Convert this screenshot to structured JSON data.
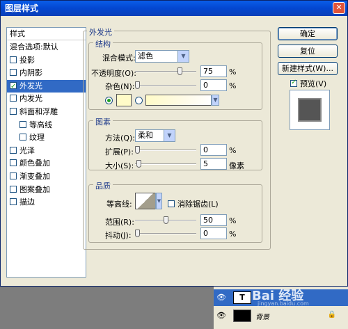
{
  "window": {
    "title": "图层样式",
    "close_glyph": "✕"
  },
  "left_list": {
    "header": "样式",
    "items": [
      {
        "label": "混合选项:默认",
        "checkbox": false,
        "checked": false,
        "selected": false,
        "indent": 0
      },
      {
        "label": "投影",
        "checkbox": true,
        "checked": false,
        "selected": false,
        "indent": 0
      },
      {
        "label": "内阴影",
        "checkbox": true,
        "checked": false,
        "selected": false,
        "indent": 0
      },
      {
        "label": "外发光",
        "checkbox": true,
        "checked": true,
        "selected": true,
        "indent": 0
      },
      {
        "label": "内发光",
        "checkbox": true,
        "checked": false,
        "selected": false,
        "indent": 0
      },
      {
        "label": "斜面和浮雕",
        "checkbox": true,
        "checked": false,
        "selected": false,
        "indent": 0
      },
      {
        "label": "等高线",
        "checkbox": true,
        "checked": false,
        "selected": false,
        "indent": 1
      },
      {
        "label": "纹理",
        "checkbox": true,
        "checked": false,
        "selected": false,
        "indent": 1
      },
      {
        "label": "光泽",
        "checkbox": true,
        "checked": false,
        "selected": false,
        "indent": 0
      },
      {
        "label": "颜色叠加",
        "checkbox": true,
        "checked": false,
        "selected": false,
        "indent": 0
      },
      {
        "label": "渐变叠加",
        "checkbox": true,
        "checked": false,
        "selected": false,
        "indent": 0
      },
      {
        "label": "图案叠加",
        "checkbox": true,
        "checked": false,
        "selected": false,
        "indent": 0
      },
      {
        "label": "描边",
        "checkbox": true,
        "checked": false,
        "selected": false,
        "indent": 0
      }
    ]
  },
  "panel": {
    "title": "外发光",
    "structure": {
      "title": "结构",
      "blend_mode_label": "混合模式:",
      "blend_mode_value": "滤色",
      "opacity_label": "不透明度(O):",
      "opacity_value": "75",
      "opacity_unit": "%",
      "opacity_level": 75,
      "noise_label": "杂色(N):",
      "noise_value": "0",
      "noise_unit": "%",
      "noise_level": 0,
      "glow_color": "#fffbc8"
    },
    "elements": {
      "title": "图素",
      "method_label": "方法(Q):",
      "method_value": "柔和",
      "spread_label": "扩展(P):",
      "spread_value": "0",
      "spread_unit": "%",
      "spread_level": 0,
      "size_label": "大小(S):",
      "size_value": "5",
      "size_unit": "像素",
      "size_level": 2
    },
    "quality": {
      "title": "品质",
      "contour_label": "等高线:",
      "antialias_label": "消除锯齿(L)",
      "antialias_checked": false,
      "range_label": "范围(R):",
      "range_value": "50",
      "range_unit": "%",
      "range_level": 50,
      "jitter_label": "抖动(J):",
      "jitter_value": "0",
      "jitter_unit": "%",
      "jitter_level": 0
    }
  },
  "buttons": {
    "ok": "确定",
    "reset": "复位",
    "new_style": "新建样式(W)...",
    "preview_label": "预览(V)",
    "preview_checked": true
  },
  "layers_panel": {
    "rows": [
      {
        "thumb": "T",
        "name": "",
        "selected": true
      },
      {
        "thumb": "",
        "name": "背景",
        "selected": false,
        "locked": true
      }
    ],
    "eye_glyph": "👁",
    "lock_glyph": "🔒"
  },
  "watermark": {
    "text": "Bai 经验",
    "sub": "jingyan.baidu.com"
  }
}
